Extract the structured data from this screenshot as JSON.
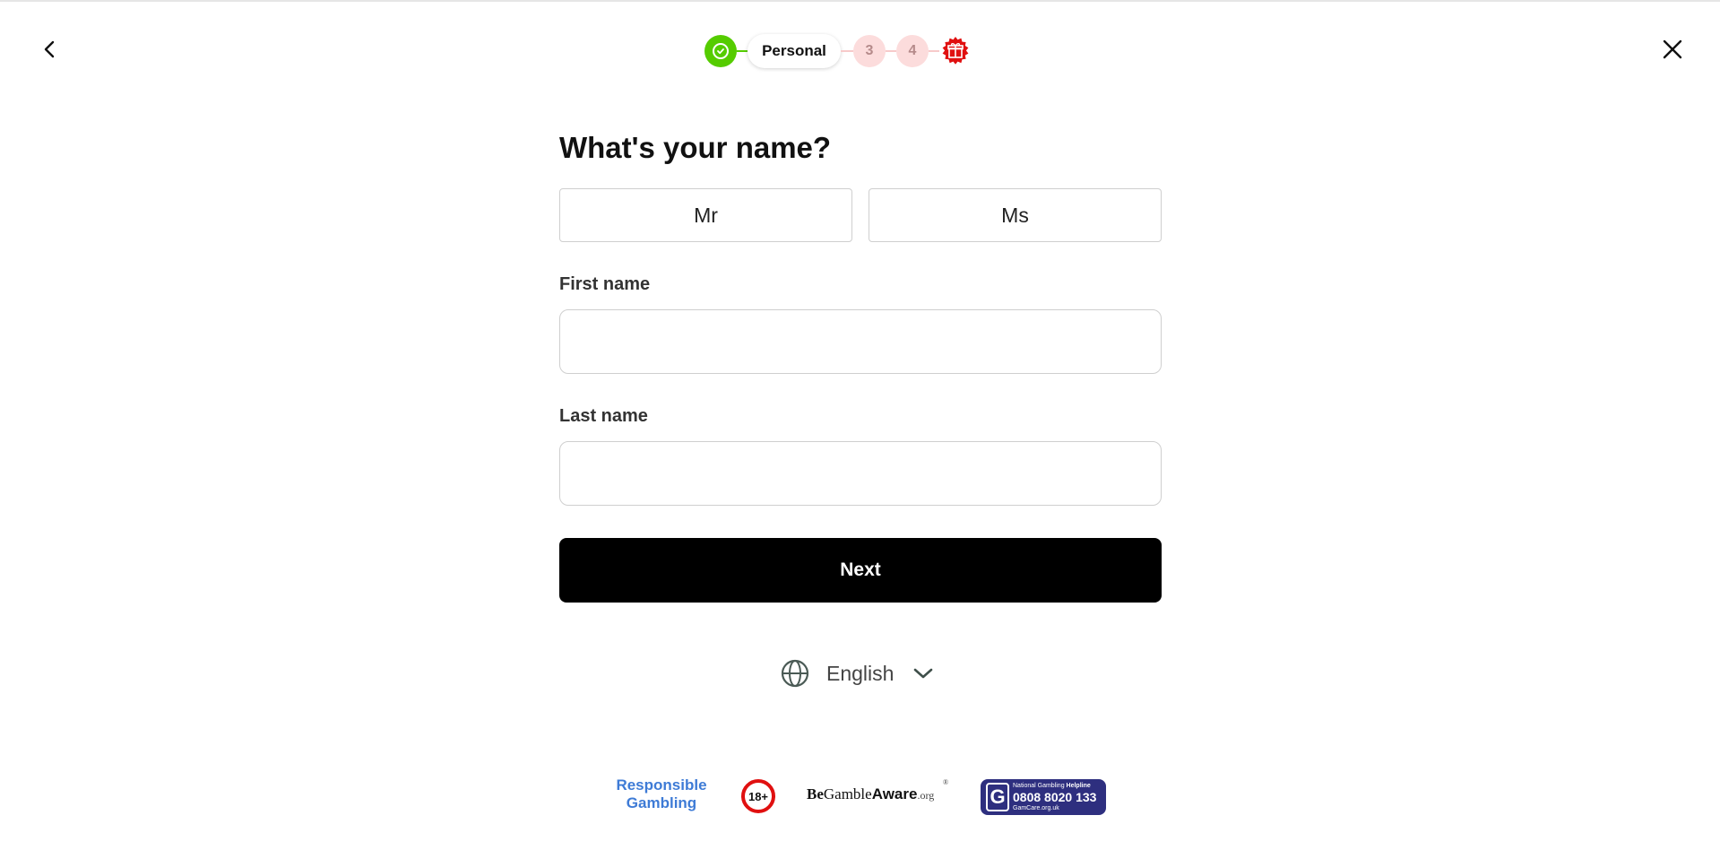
{
  "stepper": {
    "current_step_label": "Personal",
    "step3": "3",
    "step4": "4",
    "colors": {
      "done": "#55cc00",
      "pending": "#fcdcdc",
      "gift": "#e01010"
    }
  },
  "form": {
    "title": "What's your name?",
    "salutations": {
      "mr": "Mr",
      "ms": "Ms"
    },
    "first_name": {
      "label": "First name",
      "value": "",
      "placeholder": ""
    },
    "last_name": {
      "label": "Last name",
      "value": "",
      "placeholder": ""
    },
    "next_label": "Next"
  },
  "language": {
    "selected": "English"
  },
  "footer": {
    "responsible_gambling": "Responsible Gambling",
    "age_badge": "18+",
    "begambleaware": {
      "be": "Be",
      "gamble": "Gamble",
      "aware": "Aware",
      "org": ".org",
      "registered": "®"
    },
    "gamcare": {
      "helpline_prefix": "National Gambling ",
      "helpline_bold": "Helpline",
      "phone": "0808 8020 133",
      "site": "GamCare.org.uk",
      "letter": "G"
    }
  },
  "icons": {
    "back": "chevron-left-icon",
    "close": "close-icon",
    "done": "check-icon",
    "gift": "gift-icon",
    "globe": "globe-icon",
    "dropdown": "chevron-down-icon"
  }
}
